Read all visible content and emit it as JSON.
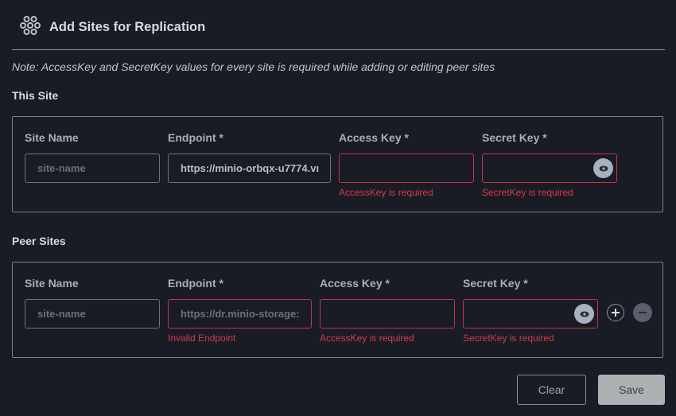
{
  "header": {
    "icon": "cluster-icon",
    "title": "Add Sites for Replication"
  },
  "note": "Note: AccessKey and SecretKey values for every site is required while adding or editing peer sites",
  "this_site": {
    "section_title": "This Site",
    "labels": {
      "site_name": "Site Name",
      "endpoint": "Endpoint *",
      "access_key": "Access Key *",
      "secret_key": "Secret Key *"
    },
    "fields": {
      "site_name": {
        "value": "",
        "placeholder": "site-name"
      },
      "endpoint": {
        "value": "https://minio-orbqx-u7774.vı",
        "placeholder": ""
      },
      "access_key": {
        "value": "",
        "placeholder": ""
      },
      "secret_key": {
        "value": "",
        "placeholder": ""
      }
    },
    "errors": {
      "access_key": "AccessKey is required",
      "secret_key": "SecretKey is required"
    },
    "show_secret_icon": "eye-icon"
  },
  "peer_sites": {
    "section_title": "Peer Sites",
    "labels": {
      "site_name": "Site Name",
      "endpoint": "Endpoint *",
      "access_key": "Access Key *",
      "secret_key": "Secret Key *"
    },
    "rows": [
      {
        "fields": {
          "site_name": {
            "value": "",
            "placeholder": "site-name"
          },
          "endpoint": {
            "value": "",
            "placeholder": "https://dr.minio-storage:"
          },
          "access_key": {
            "value": "",
            "placeholder": ""
          },
          "secret_key": {
            "value": "",
            "placeholder": ""
          }
        },
        "errors": {
          "endpoint": "Invalid Endpoint",
          "access_key": "AccessKey is required",
          "secret_key": "SecretKey is required"
        },
        "show_secret_icon": "eye-icon",
        "add_icon": "plus-icon",
        "remove_icon": "minus-icon"
      }
    ]
  },
  "actions": {
    "clear_label": "Clear",
    "save_label": "Save"
  },
  "colors": {
    "background": "#191c24",
    "error": "#d6394f",
    "error_border": "#c4334c",
    "save_button": "#adb1b3"
  }
}
